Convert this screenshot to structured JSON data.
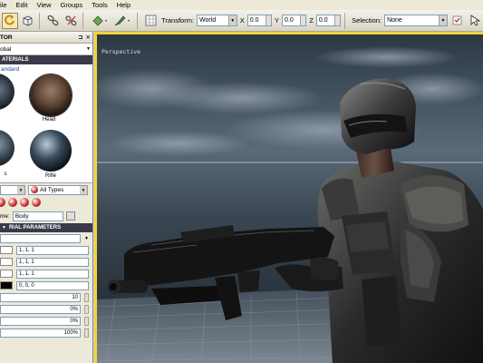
{
  "menu": {
    "items": [
      "File",
      "Edit",
      "View",
      "Groups",
      "Tools",
      "Help"
    ],
    "visible": [
      "ile",
      "Edit",
      "View",
      "Groups",
      "Tools",
      "Help"
    ]
  },
  "toolbar": {
    "transform_label": "Transform:",
    "transform_value": "World",
    "x_label": "X",
    "x_value": "0.0",
    "y_label": "Y",
    "y_value": "0.0",
    "z_label": "Z",
    "z_value": "0.0",
    "selection_label": "Selection:",
    "selection_value": "None"
  },
  "left_panel": {
    "title": "TOR",
    "pin": "⊐",
    "close": "✕",
    "scope_value": "obal",
    "materials_header": "ATERIALS",
    "materials_sub": "andard",
    "materials": [
      {
        "label": "Head"
      },
      {
        "label": "s"
      },
      {
        "label": "Rifle"
      }
    ],
    "filter_value": "",
    "types_value": "All Types",
    "name_label": "me:",
    "name_value": "Body",
    "params_header": "RIAL PARAMETERS",
    "params": [
      {
        "value": "1, 1, 1",
        "swatch": "#ffffff"
      },
      {
        "value": "1, 1, 1",
        "swatch": "#ffffff"
      },
      {
        "value": "1, 1, 1",
        "swatch": "#ffffff"
      },
      {
        "value": "0, 0, 0",
        "swatch": "#000000"
      }
    ],
    "numeric_params": [
      "10",
      "0%",
      "0%",
      "100%"
    ]
  },
  "viewport": {
    "label": "Perspective"
  },
  "colors": {
    "viewport_border": "#f4d23a",
    "section_header": "#3a3a4a"
  }
}
